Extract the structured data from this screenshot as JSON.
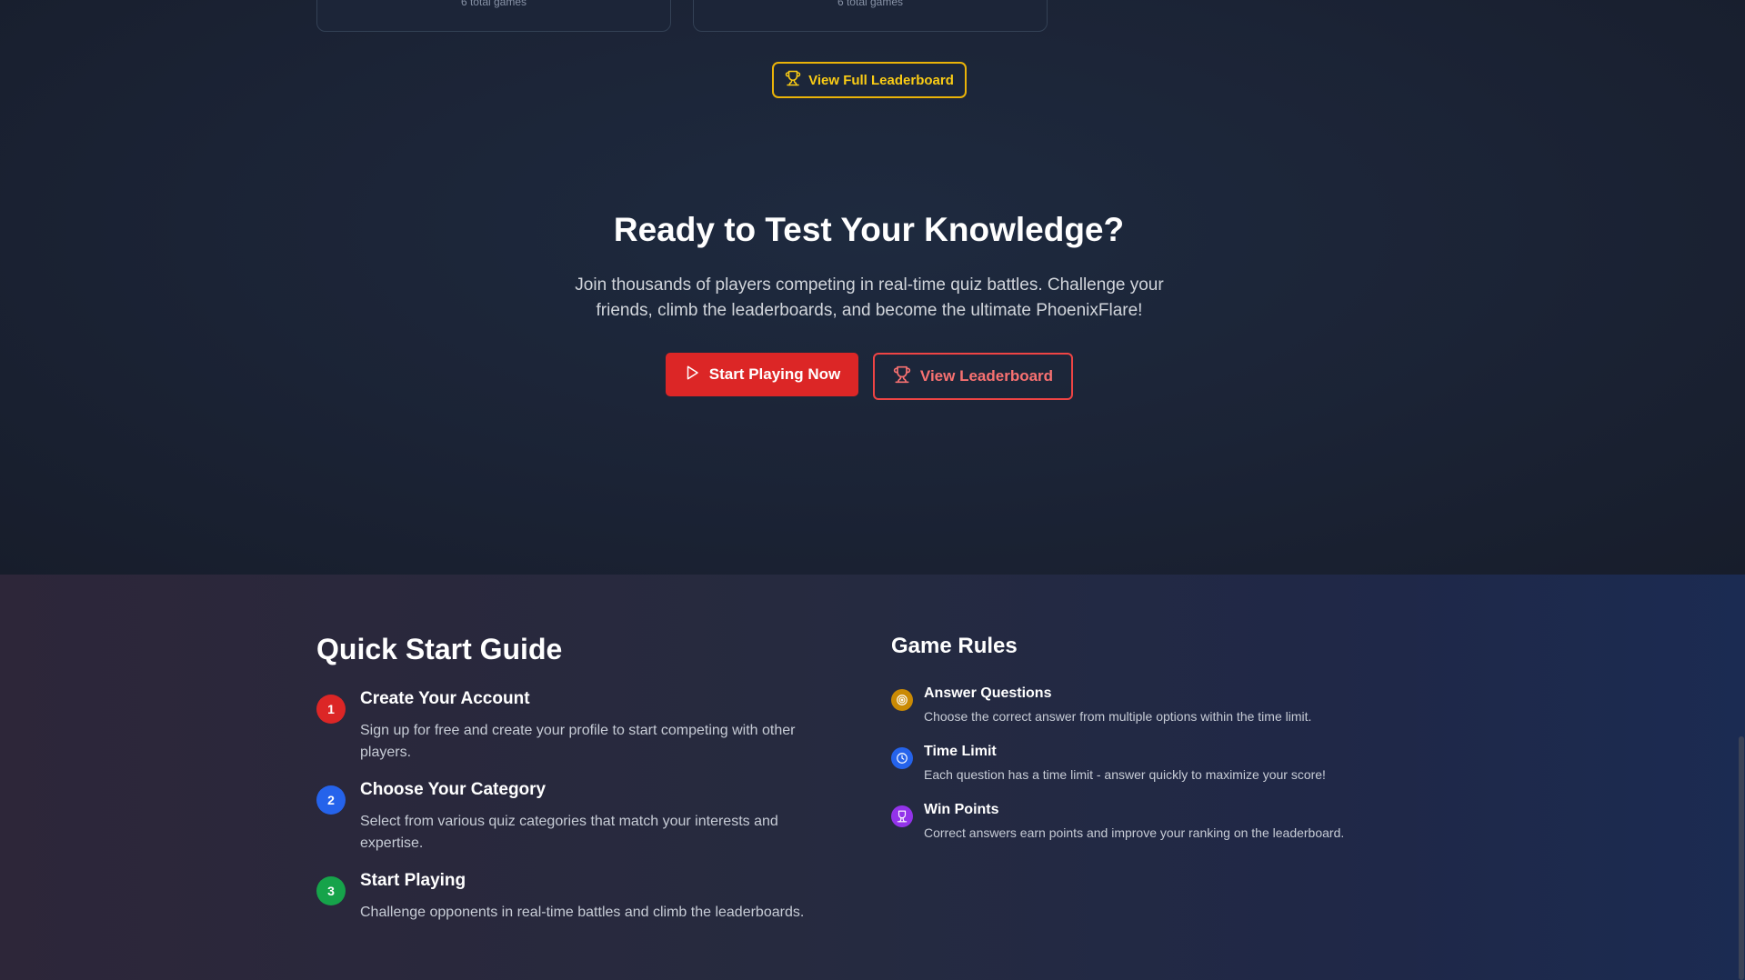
{
  "stats": {
    "card_left_games": "6 total games",
    "card_right_games": "6 total games",
    "view_full_label": "View Full Leaderboard"
  },
  "hero": {
    "title": "Ready to Test Your Knowledge?",
    "subtitle": "Join thousands of players competing in real-time quiz battles. Challenge your friends, climb the leaderboards, and become the ultimate PhoenixFlare!",
    "start_label": "Start Playing Now",
    "leaderboard_label": "View Leaderboard"
  },
  "guide": {
    "title": "Quick Start Guide",
    "steps": [
      {
        "num": "1",
        "title": "Create Your Account",
        "desc": "Sign up for free and create your profile to start competing with other players.",
        "color": "#dc2626"
      },
      {
        "num": "2",
        "title": "Choose Your Category",
        "desc": "Select from various quiz categories that match your interests and expertise.",
        "color": "#2563eb"
      },
      {
        "num": "3",
        "title": "Start Playing",
        "desc": "Challenge opponents in real-time battles and climb the leaderboards.",
        "color": "#16a34a"
      }
    ]
  },
  "rules": {
    "title": "Game Rules",
    "items": [
      {
        "title": "Answer Questions",
        "desc": "Choose the correct answer from multiple options within the time limit.",
        "color": "#ca8a04",
        "icon": "target-icon"
      },
      {
        "title": "Time Limit",
        "desc": "Each question has a time limit - answer quickly to maximize your score!",
        "color": "#2563eb",
        "icon": "clock-icon"
      },
      {
        "title": "Win Points",
        "desc": "Correct answers earn points and improve your ranking on the leaderboard.",
        "color": "#9333ea",
        "icon": "trophy-icon"
      }
    ]
  },
  "colors": {
    "accent_red": "#dc2626",
    "accent_yellow": "#eab308"
  }
}
